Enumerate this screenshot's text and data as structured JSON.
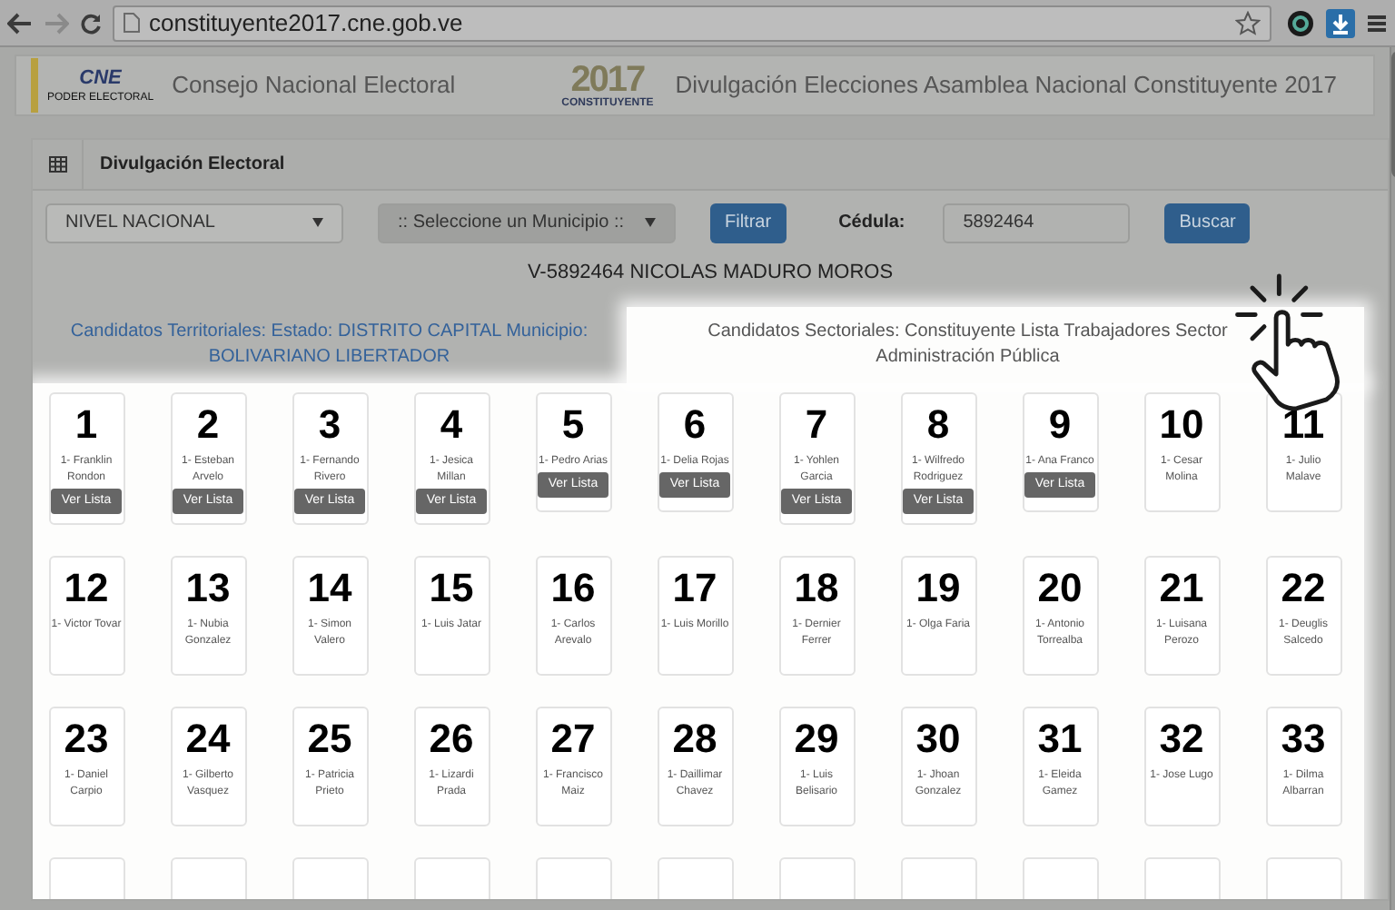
{
  "browser": {
    "url": "constituyente2017.cne.gob.ve"
  },
  "header": {
    "logo_text": "CNE",
    "logo_subtext": "PODER ELECTORAL",
    "org": "Consejo Nacional Electoral",
    "event_logo_year": "2017",
    "event_logo_word": "CONSTITUYENTE",
    "title": "Divulgación Elecciones Asamblea Nacional Constituyente 2017"
  },
  "panel": {
    "title": "Divulgación Electoral"
  },
  "filters": {
    "state_select": {
      "value": "NIVEL NACIONAL",
      "disabled": false
    },
    "municipio_select": {
      "value": ":: Seleccione un Municipio ::",
      "disabled": true
    },
    "filter_button": "Filtrar",
    "cedula_label": "Cédula:",
    "cedula_value": "5892464",
    "search_button": "Buscar"
  },
  "voter": "V-5892464 NICOLAS MADURO MOROS",
  "tabs": [
    {
      "label": "Candidatos Territoriales: Estado: DISTRITO CAPITAL Municipio: BOLIVARIANO LIBERTADOR",
      "selected": false
    },
    {
      "label": "Candidatos Sectoriales: Constituyente Lista Trabajadores Sector Administración Pública",
      "selected": true
    }
  ],
  "cards": [
    {
      "number": "1",
      "name": "1- Franklin Rondon",
      "button": "Ver Lista"
    },
    {
      "number": "2",
      "name": "1- Esteban Arvelo",
      "button": "Ver Lista"
    },
    {
      "number": "3",
      "name": "1- Fernando Rivero",
      "button": "Ver Lista"
    },
    {
      "number": "4",
      "name": "1- Jesica Millan",
      "button": "Ver Lista"
    },
    {
      "number": "5",
      "name": "1- Pedro Arias",
      "button": "Ver Lista"
    },
    {
      "number": "6",
      "name": "1- Delia Rojas",
      "button": "Ver Lista"
    },
    {
      "number": "7",
      "name": "1- Yohlen Garcia",
      "button": "Ver Lista"
    },
    {
      "number": "8",
      "name": "1- Wilfredo Rodriguez",
      "button": "Ver Lista"
    },
    {
      "number": "9",
      "name": "1- Ana Franco",
      "button": "Ver Lista"
    },
    {
      "number": "10",
      "name": "1- Cesar Molina"
    },
    {
      "number": "11",
      "name": "1- Julio Malave"
    },
    {
      "number": "12",
      "name": "1- Victor Tovar"
    },
    {
      "number": "13",
      "name": "1- Nubia Gonzalez"
    },
    {
      "number": "14",
      "name": "1- Simon Valero"
    },
    {
      "number": "15",
      "name": "1- Luis Jatar"
    },
    {
      "number": "16",
      "name": "1- Carlos Arevalo"
    },
    {
      "number": "17",
      "name": "1- Luis Morillo"
    },
    {
      "number": "18",
      "name": "1- Dernier Ferrer"
    },
    {
      "number": "19",
      "name": "1- Olga Faria"
    },
    {
      "number": "20",
      "name": "1- Antonio Torrealba"
    },
    {
      "number": "21",
      "name": "1- Luisana Perozo"
    },
    {
      "number": "22",
      "name": "1- Deuglis Salcedo"
    },
    {
      "number": "23",
      "name": "1- Daniel Carpio"
    },
    {
      "number": "24",
      "name": "1- Gilberto Vasquez"
    },
    {
      "number": "25",
      "name": "1- Patricia Prieto"
    },
    {
      "number": "26",
      "name": "1- Lizardi Prada"
    },
    {
      "number": "27",
      "name": "1- Francisco Maiz"
    },
    {
      "number": "28",
      "name": "1- Daillimar Chavez"
    },
    {
      "number": "29",
      "name": "1- Luis Belisario"
    },
    {
      "number": "30",
      "name": "1- Jhoan Gonzalez"
    },
    {
      "number": "31",
      "name": "1- Eleida Gamez"
    },
    {
      "number": "32",
      "name": "1- Jose Lugo"
    },
    {
      "number": "33",
      "name": "1- Dilma Albarran"
    }
  ],
  "cut_off_cards": [
    {
      "kind": "blank"
    },
    {
      "kind": "blank"
    },
    {
      "kind": "blank"
    },
    {
      "kind": "blank"
    },
    {
      "kind": "blank"
    },
    {
      "kind": "blank"
    },
    {
      "kind": "blank"
    },
    {
      "kind": "blank"
    },
    {
      "kind": "blank"
    },
    {
      "kind": "blank"
    },
    {
      "kind": "blank"
    }
  ]
}
